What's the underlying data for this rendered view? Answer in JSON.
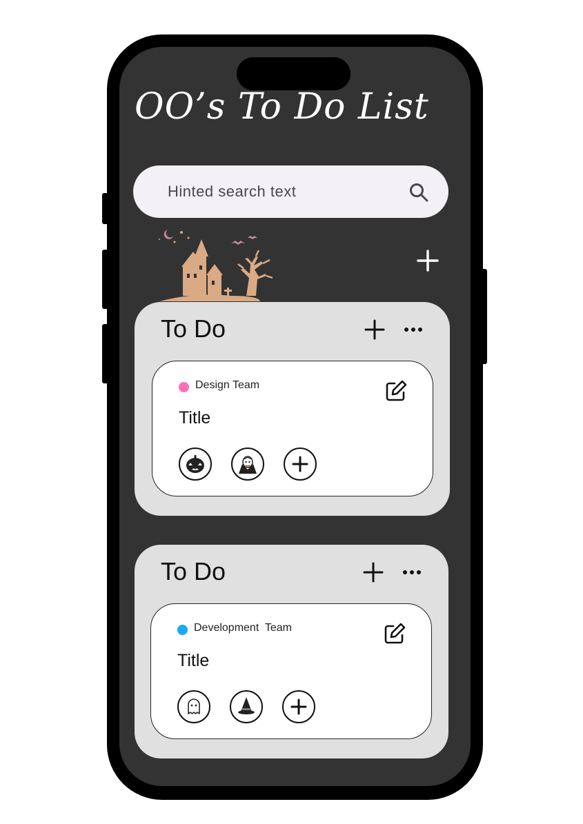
{
  "app": {
    "title": "OO’s To Do List"
  },
  "search": {
    "placeholder": "Hinted search text"
  },
  "lists": [
    {
      "title": "To Do",
      "card": {
        "team_label": "Design Team",
        "team_color": "#ff6fb7",
        "title": "Title",
        "assignees": [
          "pumpkin-icon",
          "vampire-icon"
        ]
      }
    },
    {
      "title": "To Do",
      "card": {
        "team_label": "Development  Team",
        "team_color": "#1aa9f5",
        "title": "Title",
        "assignees": [
          "ghost-icon",
          "witch-hat-icon"
        ]
      }
    }
  ],
  "colors": {
    "screen_bg": "#333333",
    "list_bg": "#e0e0e0",
    "decoration": "#d9aa83",
    "search_bg": "#f3f1f6"
  }
}
